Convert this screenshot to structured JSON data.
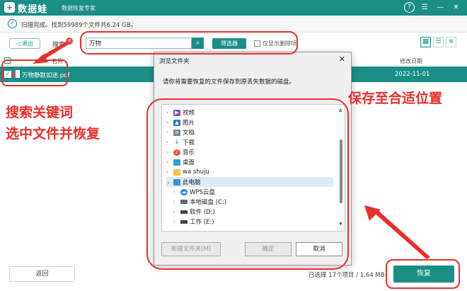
{
  "app": {
    "logo_glyph": "+",
    "name": "数据蛙",
    "subtitle": "数据恢复专家",
    "title_icons": [
      "help-icon",
      "menu-icon",
      "minimize-icon",
      "close-icon"
    ]
  },
  "scan": {
    "status": "扫描完成。找到59989个文件共6.24 GB。"
  },
  "toolbar": {
    "back_label": "退出",
    "search_label": "搜索",
    "search_value": "万物",
    "filter_label": "筛选器",
    "deleted_only_label": "仅显示删除项"
  },
  "table": {
    "columns": {
      "name": "名称",
      "date": "修改日期"
    },
    "rows": [
      {
        "name": "万物静默如迷.pdf",
        "date": "2022-11-01",
        "selected": true
      }
    ]
  },
  "annotations": {
    "left": [
      "搜索关键词",
      "选中文件并恢复"
    ],
    "right": "保存至合适位置"
  },
  "dialog": {
    "title": "浏览文件夹",
    "close_glyph": "✕",
    "message": "请你将需要恢复的文件保存到原丢失数据的磁盘。",
    "tree": [
      {
        "label": "视频",
        "icon": "video-folder-icon",
        "level": 0
      },
      {
        "label": "图片",
        "icon": "picture-folder-icon",
        "level": 0
      },
      {
        "label": "文档",
        "icon": "document-folder-icon",
        "level": 0
      },
      {
        "label": "下载",
        "icon": "download-icon",
        "level": 0
      },
      {
        "label": "音乐",
        "icon": "music-icon",
        "level": 0
      },
      {
        "label": "桌面",
        "icon": "desktop-icon",
        "level": 0
      },
      {
        "label": "wa shuju",
        "icon": "folder-icon",
        "level": 0
      },
      {
        "label": "此电脑",
        "icon": "computer-icon",
        "level": 0,
        "expanded": true
      },
      {
        "label": "WPS云盘",
        "icon": "cloud-icon",
        "level": 1
      },
      {
        "label": "本地磁盘 (C:)",
        "icon": "drive-c-icon",
        "level": 1
      },
      {
        "label": "软件 (D:)",
        "icon": "drive-icon",
        "level": 1
      },
      {
        "label": "工作 (E:)",
        "icon": "drive-icon",
        "level": 1
      }
    ],
    "buttons": {
      "new_folder": "新建文件夹(M)",
      "ok": "确定",
      "cancel": "取消"
    }
  },
  "bottom": {
    "back_label": "返回",
    "status": "已选择 17个项目 / 1.64 MB",
    "recover_label": "恢复"
  },
  "colors": {
    "brand": "#1b8f86",
    "annotation": "#e8302a"
  }
}
